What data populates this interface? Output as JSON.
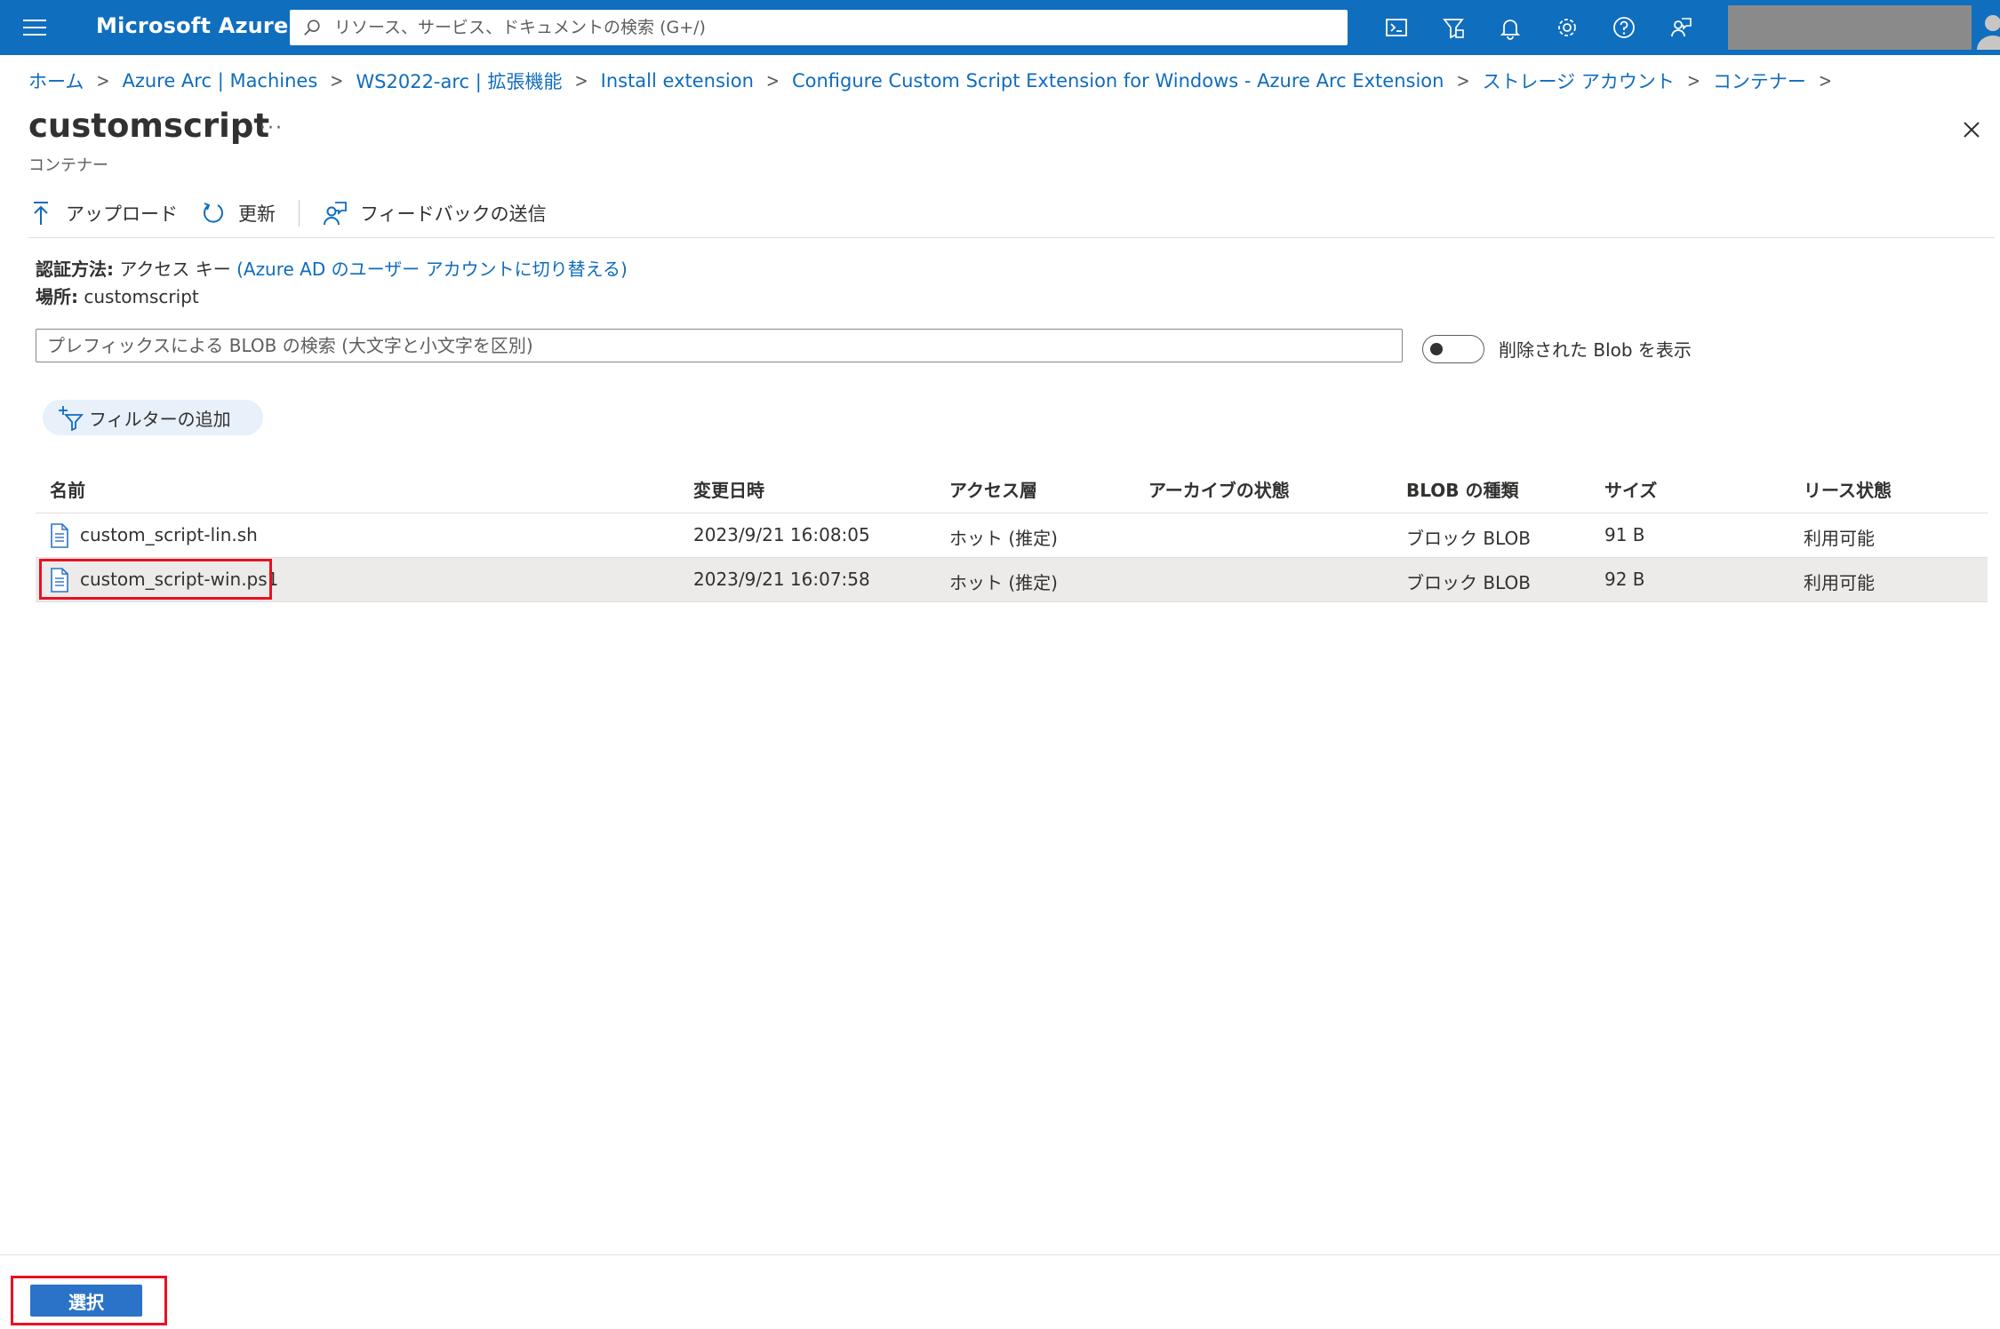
{
  "topbar": {
    "brand": "Microsoft Azure",
    "search_placeholder": "リソース、サービス、ドキュメントの検索 (G+/)",
    "icons": [
      "cloud-shell-icon",
      "directory-filter-icon",
      "notifications-icon",
      "settings-icon",
      "help-icon",
      "feedback-icon"
    ]
  },
  "breadcrumb": {
    "items": [
      "ホーム",
      "Azure Arc | Machines",
      "WS2022-arc | 拡張機能",
      "Install extension",
      "Configure Custom Script Extension for Windows - Azure Arc Extension",
      "ストレージ アカウント",
      "コンテナー"
    ],
    "separator": ">"
  },
  "header": {
    "title": "customscript",
    "more": "···",
    "subtitle": "コンテナー"
  },
  "toolbar": {
    "upload_label": "アップロード",
    "refresh_label": "更新",
    "feedback_label": "フィードバックの送信"
  },
  "info": {
    "auth_label": "認証方法:",
    "auth_value": "アクセス キー",
    "auth_link": "(Azure AD のユーザー アカウントに切り替える)",
    "location_label": "場所:",
    "location_value": "customscript"
  },
  "search": {
    "placeholder": "プレフィックスによる BLOB の検索 (大文字と小文字を区別)"
  },
  "toggle": {
    "label": "削除された Blob を表示",
    "on": false
  },
  "filter": {
    "label": "フィルターの追加"
  },
  "table": {
    "headers": {
      "name": "名前",
      "modified": "変更日時",
      "tier": "アクセス層",
      "archive": "アーカイブの状態",
      "type": "BLOB の種類",
      "size": "サイズ",
      "lease": "リース状態"
    },
    "rows": [
      {
        "name": "custom_script-lin.sh",
        "modified": "2023/9/21 16:08:05",
        "tier": "ホット (推定)",
        "archive": "",
        "type": "ブロック BLOB",
        "size": "91 B",
        "lease": "利用可能",
        "selected": false
      },
      {
        "name": "custom_script-win.ps1",
        "modified": "2023/9/21 16:07:58",
        "tier": "ホット (推定)",
        "archive": "",
        "type": "ブロック BLOB",
        "size": "92 B",
        "lease": "利用可能",
        "selected": true
      }
    ]
  },
  "footer": {
    "select_label": "選択"
  },
  "colors": {
    "topbar": "#106ebe",
    "link": "#0f6cbd",
    "highlight": "#e81123",
    "selected_row": "#edebe9"
  }
}
